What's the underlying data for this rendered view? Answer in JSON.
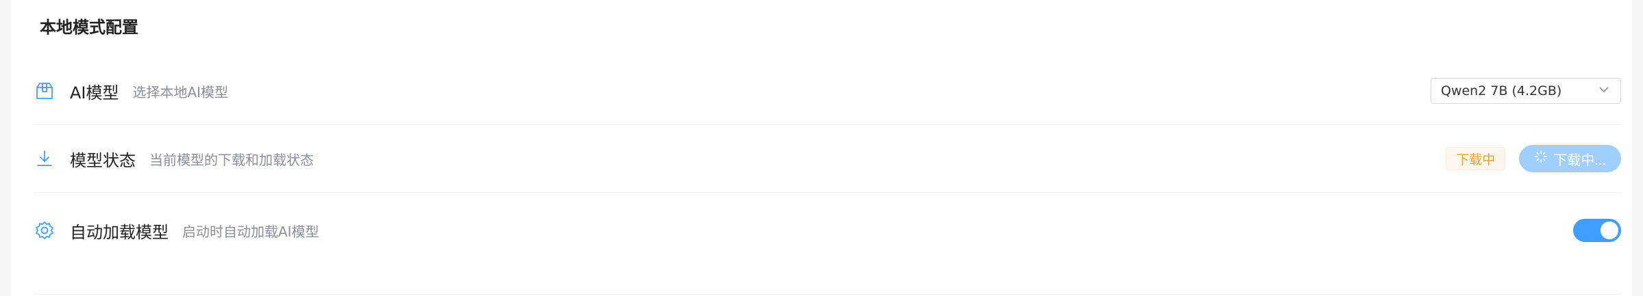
{
  "section": {
    "title": "本地模式配置"
  },
  "rows": [
    {
      "icon": "box-icon",
      "label": "AI模型",
      "desc": "选择本地AI模型",
      "select_value": "Qwen2 7B (4.2GB)"
    },
    {
      "icon": "download-icon",
      "label": "模型状态",
      "desc": "当前模型的下载和加载状态",
      "status_tag": "下载中",
      "button_label": "下载中..."
    },
    {
      "icon": "gear-icon",
      "label": "自动加载模型",
      "desc": "启动时自动加载AI模型",
      "switch_on": true
    }
  ],
  "colors": {
    "accent": "#409eff",
    "icon": "#409eff",
    "warning": "#e6a23c",
    "loading_button": "#a0cfff"
  }
}
